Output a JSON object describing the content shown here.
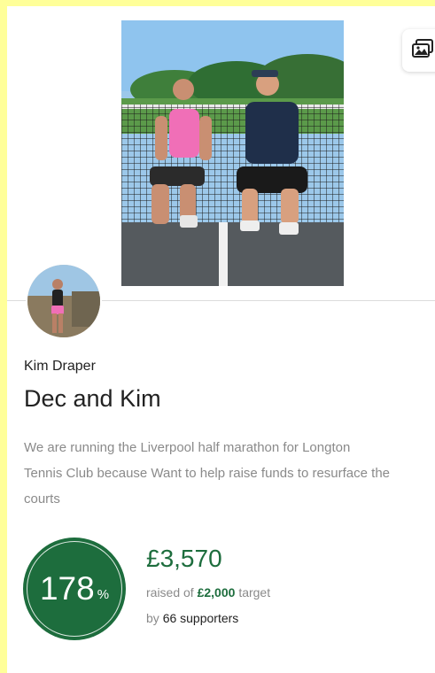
{
  "page": {
    "owner_name": "Kim Draper",
    "title": "Dec and Kim",
    "story_lines": [
      "We are running the Liverpool half marathon for Longton",
      "Tennis Club because Want to help raise funds to resurface the",
      "courts"
    ]
  },
  "stats": {
    "percent": "178",
    "percent_symbol": "%",
    "percent_value": 178,
    "raised": "£3,570",
    "raised_prefix": "raised of",
    "target": "£2,000",
    "target_suffix": "target",
    "supporters_prefix": "by",
    "supporters": "66 supporters"
  },
  "icons": {
    "gallery": "image-gallery-icon"
  },
  "colors": {
    "accent_green": "#1d6d3d",
    "background_highlight": "#ffff99"
  }
}
